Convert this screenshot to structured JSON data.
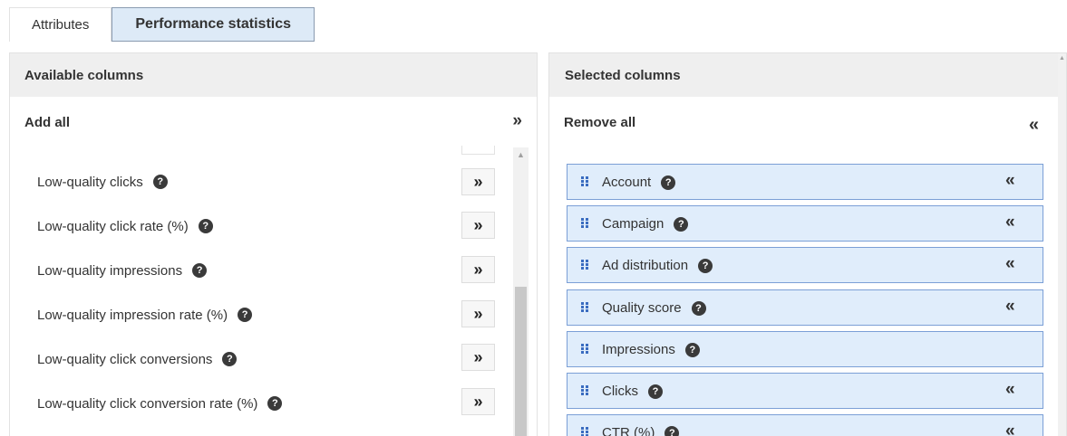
{
  "tabs": [
    {
      "label": "Attributes",
      "active": false
    },
    {
      "label": "Performance statistics",
      "active": true
    }
  ],
  "available": {
    "header": "Available columns",
    "add_all_label": "Add all",
    "add_all_icon": "»",
    "add_icon": "»",
    "items": [
      {
        "label": "Low-quality clicks"
      },
      {
        "label": "Low-quality click rate (%)"
      },
      {
        "label": "Low-quality impressions"
      },
      {
        "label": "Low-quality impression rate (%)"
      },
      {
        "label": "Low-quality click conversions"
      },
      {
        "label": "Low-quality click conversion rate (%)"
      }
    ]
  },
  "selected": {
    "header": "Selected columns",
    "remove_all_label": "Remove all",
    "remove_all_icon": "«",
    "remove_icon": "«",
    "items": [
      {
        "label": "Account",
        "removable": true
      },
      {
        "label": "Campaign",
        "removable": true
      },
      {
        "label": "Ad distribution",
        "removable": true
      },
      {
        "label": "Quality score",
        "removable": true
      },
      {
        "label": "Impressions",
        "removable": false
      },
      {
        "label": "Clicks",
        "removable": true
      },
      {
        "label": "CTR (%)",
        "removable": true
      }
    ]
  },
  "help_glyph": "?",
  "colors": {
    "selected_bg": "#e0edfb",
    "selected_border": "#7b9fd6",
    "header_bg": "#efefef",
    "active_tab_bg": "#ddeaf7"
  }
}
